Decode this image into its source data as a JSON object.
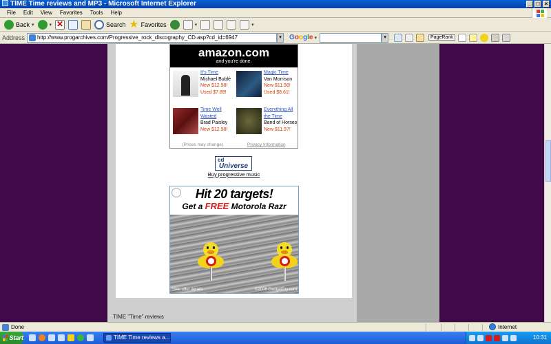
{
  "window": {
    "title": "TIME Time reviews and MP3 - Microsoft Internet Explorer"
  },
  "menu": [
    "File",
    "Edit",
    "View",
    "Favorites",
    "Tools",
    "Help"
  ],
  "toolbar": {
    "back": "Back",
    "search": "Search",
    "favorites": "Favorites"
  },
  "address": {
    "label": "Address",
    "url": "http://www.progarchives.com/Progressive_rock_discography_CD.asp?cd_id=6947",
    "google": "Google",
    "pagerank": "PageRank"
  },
  "amazon": {
    "logo": "amazon.com",
    "tagline": "and you're done.",
    "products": [
      {
        "title": "It's Time",
        "artist": "Michael Bublé",
        "new_price": "New $12.98!",
        "used_price": "Used $7.89!",
        "thumb": "#e8e8e8"
      },
      {
        "title": "Magic Time",
        "artist": "Van Morrison",
        "new_price": "New $11.98!",
        "used_price": "Used $8.61!",
        "thumb": "#1e3a5a"
      },
      {
        "title": "Time Well Wasted",
        "artist": "Brad Paisley",
        "new_price": "New $12.98!",
        "used_price": "",
        "thumb": "#7a2020"
      },
      {
        "title": "Everything All the Time",
        "artist": "Band of Horses",
        "new_price": "New $11.97!",
        "used_price": "",
        "thumb": "#4a4a2a"
      }
    ],
    "footer_left": "(Prices may change)",
    "footer_right": "Privacy Information"
  },
  "cdu": {
    "logo_top": "cd",
    "logo_bottom": "Universe",
    "link": "Buy progressive music"
  },
  "ad": {
    "headline": "Hit 20 targets!",
    "sub_before": "Get a ",
    "sub_free": "FREE",
    "sub_after": " Motorola Razr",
    "note_left": "*See offer details",
    "note_right": "©2006 GadgetToy.com"
  },
  "page": {
    "bottom_text": "TIME \"Time\" reviews"
  },
  "status": {
    "text": "Done",
    "zone": "Internet"
  },
  "taskbar": {
    "start": "Start",
    "task": "TIME Time reviews a...",
    "clock": "10:31"
  },
  "colors": {
    "background": "#3f0a47",
    "title_bar": "#0a5fd8",
    "link": "#2a54c0",
    "price": "#cc3a00"
  }
}
